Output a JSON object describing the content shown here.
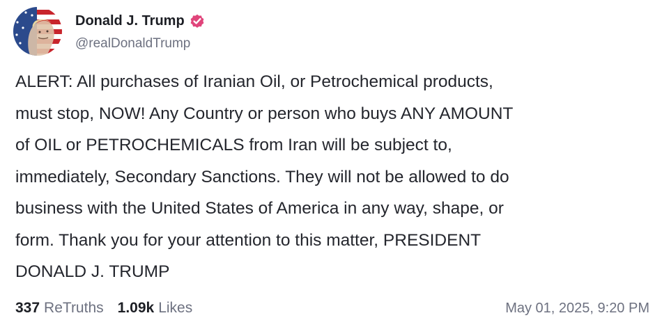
{
  "post": {
    "author": {
      "display_name": "Donald J. Trump",
      "handle": "@realDonaldTrump",
      "verified": true,
      "avatar_icon": "flag-portrait-avatar",
      "verified_icon": "verified-badge-icon",
      "verified_color": "#e0457b"
    },
    "lines": [
      "ALERT: All purchases of Iranian Oil, or Petrochemical products,",
      "must stop, NOW! Any Country or person who buys ANY AMOUNT",
      "of OIL or PETROCHEMICALS from Iran will be subject to,",
      "immediately, Secondary Sanctions. They will not be allowed to do",
      "business with the United States of America in any way, shape, or",
      "form. Thank you for your attention to this matter, PRESIDENT",
      "DONALD J. TRUMP"
    ],
    "stats": {
      "retruths_count": "337",
      "retruths_label": "ReTruths",
      "likes_count": "1.09k",
      "likes_label": "Likes"
    },
    "timestamp": "May 01, 2025, 9:20 PM"
  }
}
